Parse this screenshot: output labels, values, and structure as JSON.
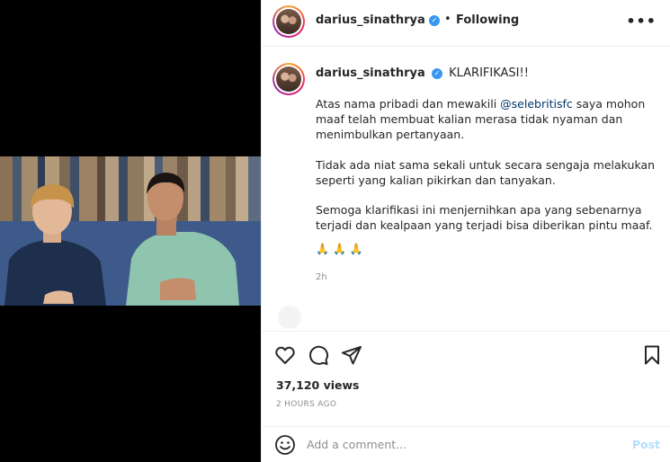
{
  "post": {
    "username": "darius_sinathrya",
    "follow_status": "Following",
    "separator": "•",
    "more_label": "•••"
  },
  "caption": {
    "username": "darius_sinathrya",
    "title": "KLARIFIKASI!!",
    "para1_before": "Atas nama pribadi dan mewakili ",
    "mention": "@selebritisfc",
    "para1_after": " saya mohon maaf telah membuat kalian merasa tidak nyaman dan menimbulkan pertanyaan.",
    "para2": "Tidak ada niat sama sekali untuk secara sengaja melakukan seperti yang kalian pikirkan dan tanyakan.",
    "para3": "Semoga klarifikasi ini menjernihkan apa yang sebenarnya terjadi dan kealpaan yang terjadi bisa diberikan pintu maaf.",
    "emojis": "🙏🙏🙏",
    "time": "2h"
  },
  "stats": {
    "views": "37,120 views",
    "posted": "2 HOURS AGO"
  },
  "comment": {
    "placeholder": "Add a comment...",
    "post_label": "Post"
  },
  "icons": {
    "like": "heart-icon",
    "comment": "speech-bubble-icon",
    "share": "paper-plane-icon",
    "save": "bookmark-icon",
    "emoji": "smiley-icon",
    "verified": "verified-badge-icon"
  },
  "colors": {
    "verified": "#3897f0",
    "mention": "#00376b",
    "post_disabled": "#b2dffc",
    "muted": "#8e8e8e"
  }
}
